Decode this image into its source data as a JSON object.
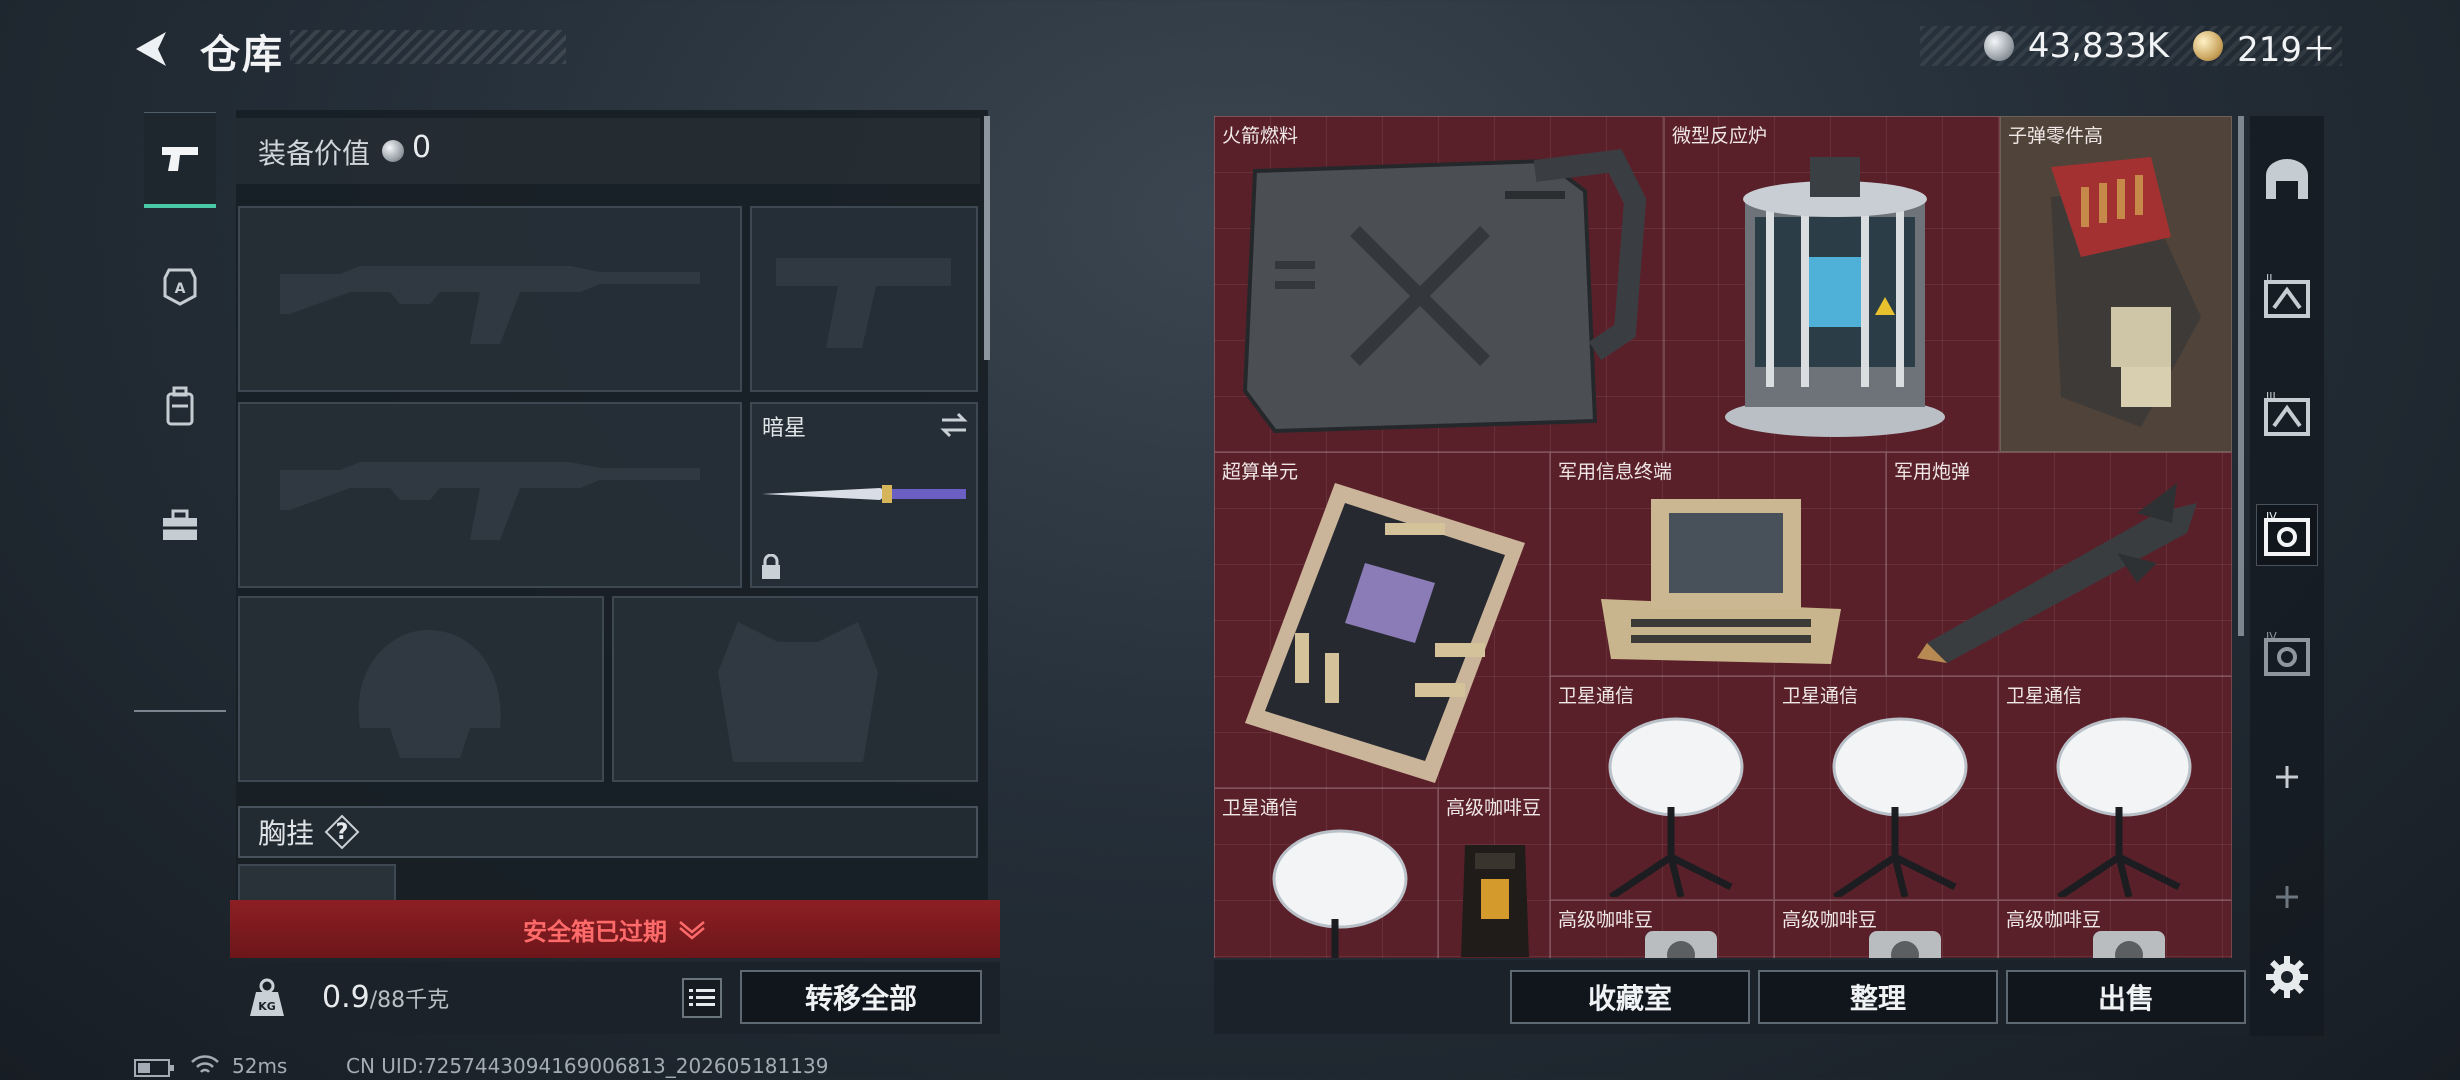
{
  "header": {
    "title": "仓库",
    "currency": [
      {
        "icon": "silver-coin-icon",
        "value": "43,833K"
      },
      {
        "icon": "gold-coin-icon",
        "value": "219＋"
      }
    ]
  },
  "left_tabs": [
    {
      "icon": "pistol-icon",
      "active": true
    },
    {
      "icon": "armor-badge-icon",
      "active": false
    },
    {
      "icon": "backpack-icon",
      "active": false
    },
    {
      "icon": "toolbox-icon",
      "active": false
    }
  ],
  "loadout": {
    "equip_label": "装备价值",
    "equip_value": "0",
    "melee_name": "暗星",
    "chest_label": "胸挂",
    "chest_help": "?"
  },
  "safe_box": {
    "status": "安全箱已过期"
  },
  "weight": {
    "current": "0.9",
    "max": "/88千克"
  },
  "buttons": {
    "transfer_all": "转移全部",
    "collection": "收藏室",
    "organize": "整理",
    "sell": "出售"
  },
  "stash_items": [
    {
      "name": "火箭燃料",
      "icon": "fuel-can-icon"
    },
    {
      "name": "微型反应炉",
      "icon": "reactor-icon"
    },
    {
      "name": "子弹零件高",
      "icon": "ammo-parts-icon"
    },
    {
      "name": "超算单元",
      "icon": "circuit-board-icon"
    },
    {
      "name": "军用信息终端",
      "icon": "terminal-icon"
    },
    {
      "name": "军用炮弹",
      "icon": "missile-icon"
    },
    {
      "name": "卫星通信",
      "icon": "satellite-dish-icon"
    },
    {
      "name": "卫星通信",
      "icon": "satellite-dish-icon"
    },
    {
      "name": "卫星通信",
      "icon": "satellite-dish-icon"
    },
    {
      "name": "卫星通信",
      "icon": "satellite-dish-icon"
    },
    {
      "name": "高级咖啡豆",
      "icon": "coffee-bag-icon"
    },
    {
      "name": "高级咖啡豆",
      "icon": "coffee-icon"
    },
    {
      "name": "高级咖啡豆",
      "icon": "coffee-icon"
    },
    {
      "name": "高级咖啡豆",
      "icon": "coffee-icon"
    }
  ],
  "right_tabs": [
    {
      "icon": "stash-main-icon"
    },
    {
      "icon": "stash-page-2-icon"
    },
    {
      "icon": "stash-page-3-icon"
    },
    {
      "icon": "stash-page-4-icon"
    },
    {
      "icon": "stash-page-5-icon"
    },
    {
      "icon": "add-icon"
    },
    {
      "icon": "add-icon"
    }
  ],
  "status_bar": {
    "ping": "52ms",
    "uid": "CN UID:7257443094169006813_202605181139"
  },
  "colors": {
    "accent": "#49c9a6",
    "grid_bg": "#5a2029",
    "safe_expired": "#8c1f24",
    "alert_text": "#ff6a6a"
  }
}
